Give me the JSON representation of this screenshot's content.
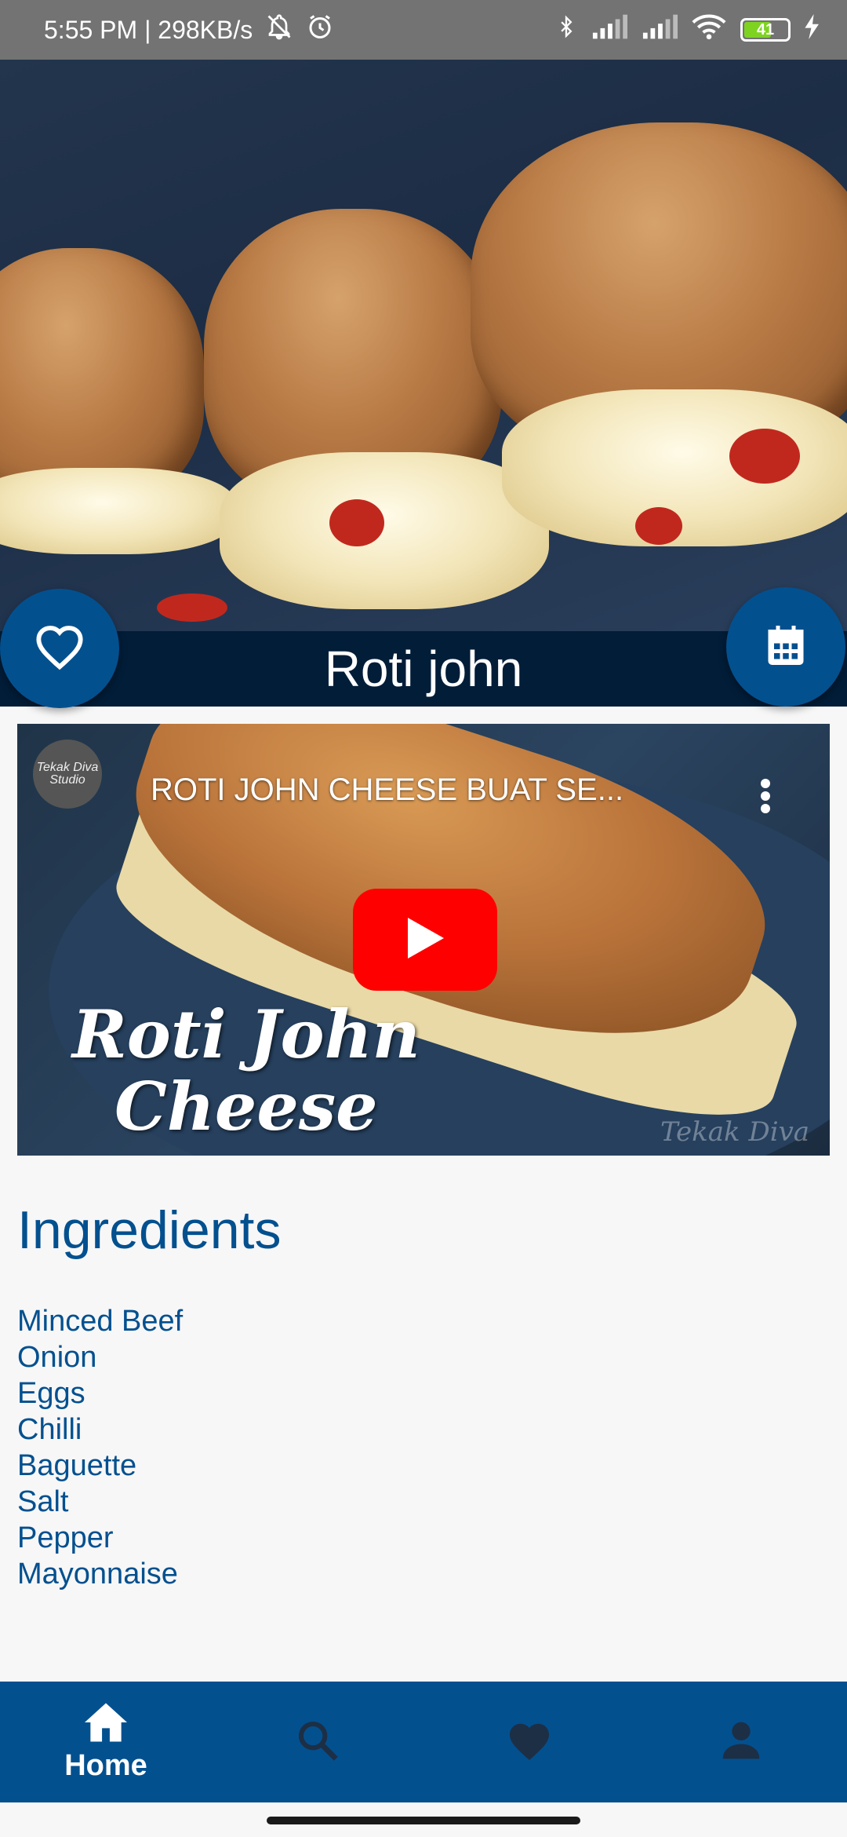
{
  "status_bar": {
    "time_info": "5:55 PM | 298KB/s",
    "battery": "41"
  },
  "recipe": {
    "title": "Roti john"
  },
  "video": {
    "channel_badge": "Tekak Diva Studio",
    "title": "ROTI JOHN CHEESE BUAT SE...",
    "overlay_line1": "Roti John",
    "overlay_line2": "Cheese",
    "watermark": "Tekak Diva"
  },
  "ingredients": {
    "heading": "Ingredients",
    "items": [
      "Minced Beef",
      "Onion",
      "Eggs",
      "Chilli",
      "Baguette",
      "Salt",
      "Pepper",
      "Mayonnaise"
    ]
  },
  "bottom_nav": {
    "items": [
      {
        "label": "Home",
        "icon": "home-icon",
        "active": true
      },
      {
        "label": "",
        "icon": "search-icon",
        "active": false
      },
      {
        "label": "",
        "icon": "heart-icon",
        "active": false
      },
      {
        "label": "",
        "icon": "person-icon",
        "active": false
      }
    ]
  },
  "colors": {
    "primary": "#03508f",
    "title_band": "#021d38",
    "status_bar": "#737373",
    "youtube_red": "#ff0000"
  }
}
